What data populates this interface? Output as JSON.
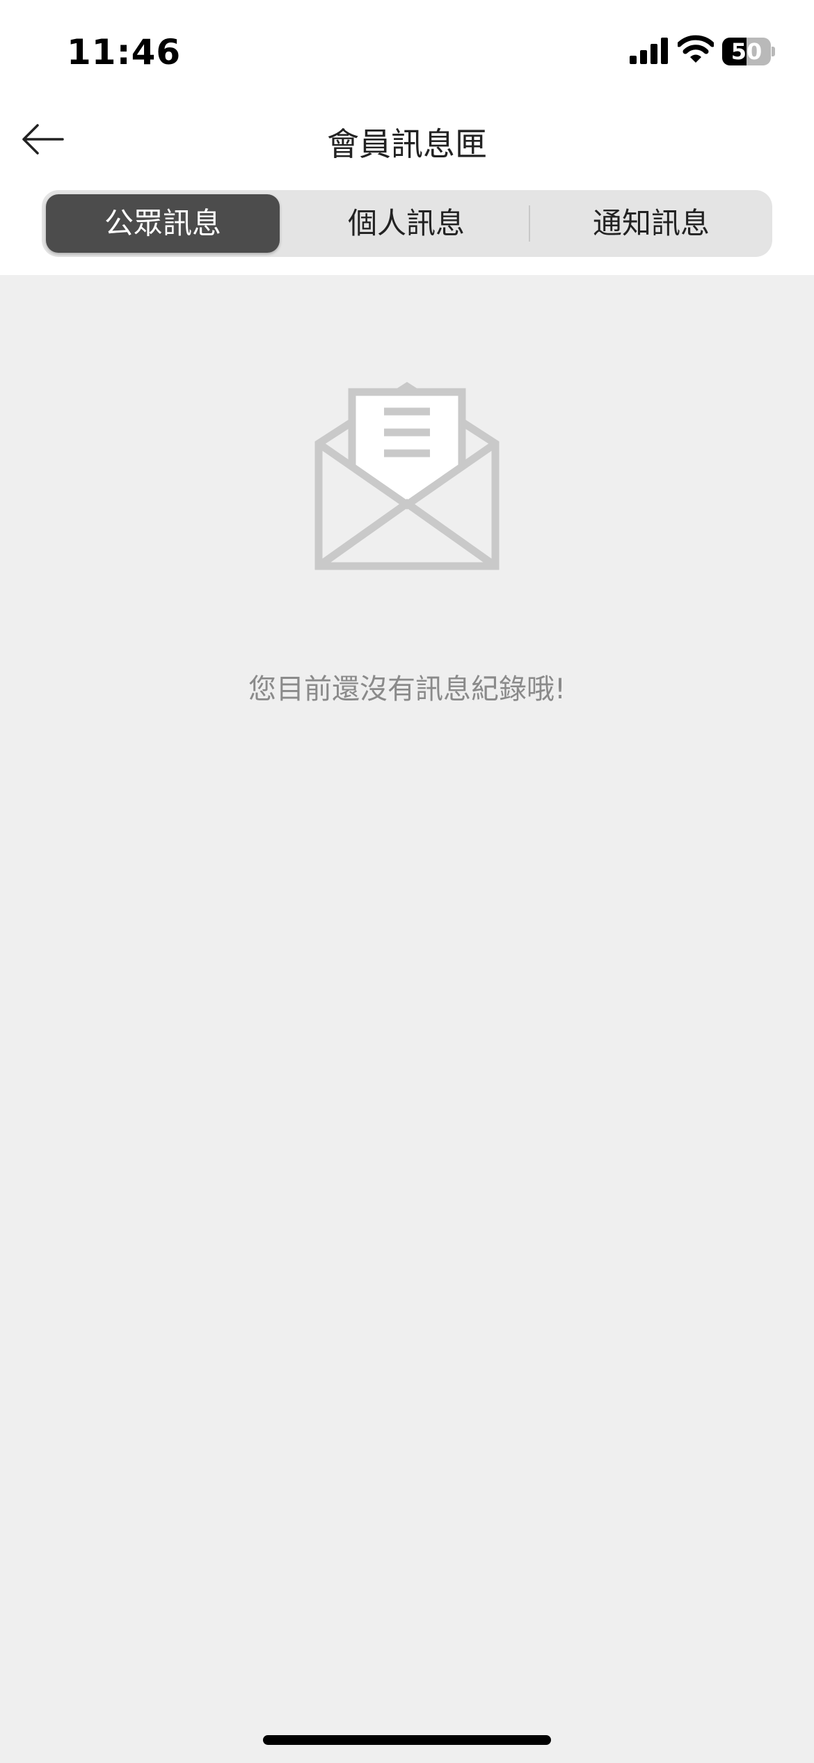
{
  "status_bar": {
    "time": "11:46",
    "battery_level": "50",
    "battery_percent": 50
  },
  "nav": {
    "title": "會員訊息匣",
    "back_icon": "arrow-left-icon"
  },
  "tabs": [
    {
      "label": "公眾訊息",
      "active": true
    },
    {
      "label": "個人訊息",
      "active": false
    },
    {
      "label": "通知訊息",
      "active": false
    }
  ],
  "empty_state": {
    "icon": "envelope-open-icon",
    "message": "您目前還沒有訊息紀錄哦!"
  },
  "colors": {
    "active_tab": "#4c4c4c",
    "tab_bar": "#e4e4e4",
    "page_background": "#efefef",
    "icon_gray": "#c9c9c9",
    "empty_text": "#8a8a8a"
  }
}
